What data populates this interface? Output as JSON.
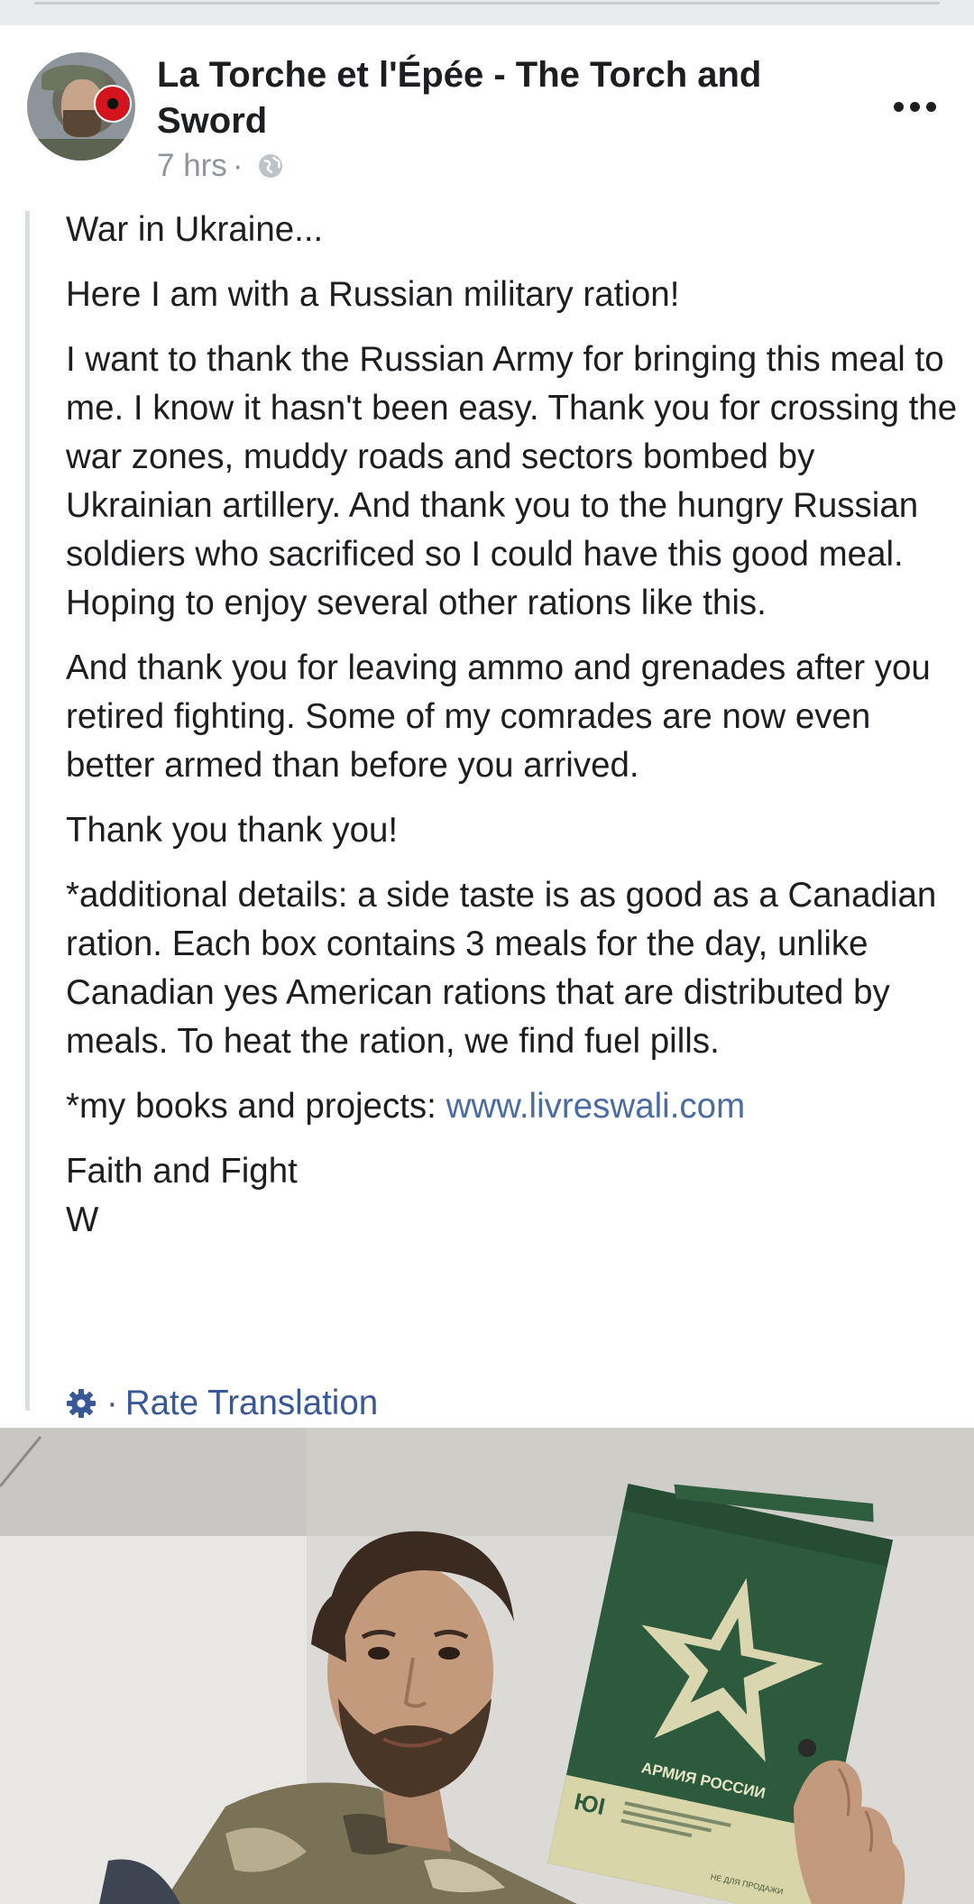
{
  "post": {
    "page_name": "La Torche et l'Épée - The Torch and Sword",
    "time": "7 hrs",
    "separator": "·",
    "paragraphs": [
      "War in Ukraine...",
      "Here I am with a Russian military ration!",
      "I want to thank the Russian Army for bringing this meal to me. I know it hasn't been easy. Thank you for crossing the war zones, muddy roads and sectors bombed by Ukrainian artillery. And thank you to the hungry Russian soldiers who sacrificed so I could have this good meal. Hoping to enjoy several other rations like this.",
      "And thank you for leaving ammo and grenades after you retired fighting. Some of my comrades are now even better armed than before you arrived.",
      "Thank you thank you!",
      "*additional details: a side taste is as good as a Canadian ration. Each box contains 3 meals for the day, unlike Canadian yes American rations that are distributed by meals. To heat the ration, we find fuel pills."
    ],
    "books_prefix": "*my books and projects: ",
    "books_link": "www.livreswali.com",
    "signoff_line1": "Faith and Fight",
    "signoff_line2": "W",
    "rate_translation": "Rate Translation"
  },
  "photo": {
    "box_text": "АРМИЯ РОССИИ",
    "box_small_text": "НЕ ДЛЯ ПРОДАЖИ"
  },
  "colors": {
    "link": "#4b6ca3",
    "action_blue": "#385898",
    "meta_gray": "#90949c",
    "box_green": "#2d5a3c"
  }
}
